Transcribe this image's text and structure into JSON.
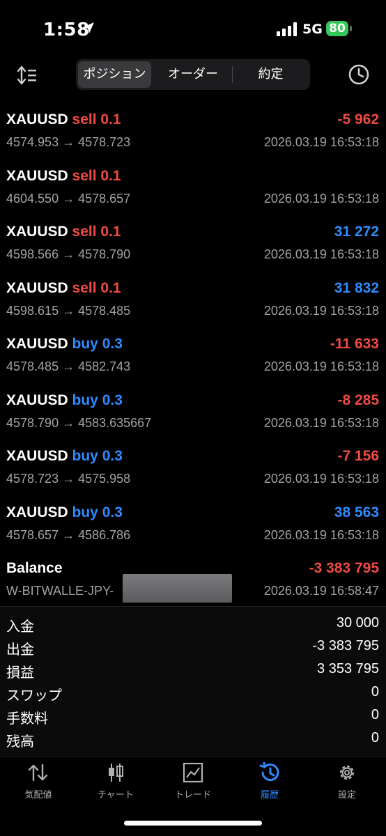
{
  "status_bar": {
    "time": "1:58",
    "network": "5G",
    "battery": "80"
  },
  "segments": [
    "ポジション",
    "オーダー",
    "約定"
  ],
  "active_segment": 0,
  "trades": [
    {
      "symbol": "XAUUSD",
      "side": "sell 0.1",
      "profit": "-5 962",
      "prices": "4574.953 → 4578.723",
      "date": "2026.03.19 16:53:18"
    },
    {
      "symbol": "XAUUSD",
      "side": "sell 0.1",
      "profit": "",
      "prices": "4604.550 → 4578.657",
      "date": "2026.03.19 16:53:18"
    },
    {
      "symbol": "XAUUSD",
      "side": "sell 0.1",
      "profit": "31 272",
      "prices": "4598.566 → 4578.790",
      "date": "2026.03.19 16:53:18"
    },
    {
      "symbol": "XAUUSD",
      "side": "sell 0.1",
      "profit": "31 832",
      "prices": "4598.615 → 4578.485",
      "date": "2026.03.19 16:53:18"
    },
    {
      "symbol": "XAUUSD",
      "side": "buy 0.3",
      "profit": "-11 633",
      "prices": "4578.485 → 4582.743",
      "date": "2026.03.19 16:53:18"
    },
    {
      "symbol": "XAUUSD",
      "side": "buy 0.3",
      "profit": "-8 285",
      "prices": "4578.790 → 4583.635667",
      "date": "2026.03.19 16:53:18"
    },
    {
      "symbol": "XAUUSD",
      "side": "buy 0.3",
      "profit": "-7 156",
      "prices": "4578.723 → 4575.958",
      "date": "2026.03.19 16:53:18"
    },
    {
      "symbol": "XAUUSD",
      "side": "buy 0.3",
      "profit": "38 563",
      "prices": "4578.657 → 4586.786",
      "date": "2026.03.19 16:53:18"
    }
  ],
  "balance": {
    "label": "Balance",
    "amount": "-3 383 795",
    "account": "W-BITWALLE-JPY-",
    "date": "2026.03.19 16:58:47"
  },
  "summary": [
    {
      "label": "入金",
      "value": "30 000"
    },
    {
      "label": "出金",
      "value": "-3 383 795"
    },
    {
      "label": "損益",
      "value": "3 353 795"
    },
    {
      "label": "スワップ",
      "value": "0"
    },
    {
      "label": "手数料",
      "value": "0"
    },
    {
      "label": "残高",
      "value": "0"
    }
  ],
  "tabs": [
    {
      "label": "気配値",
      "icon": "quotes-arrows-icon"
    },
    {
      "label": "チャート",
      "icon": "candlestick-icon"
    },
    {
      "label": "トレード",
      "icon": "trade-chart-icon"
    },
    {
      "label": "履歴",
      "icon": "history-icon"
    },
    {
      "label": "設定",
      "icon": "gear-icon"
    }
  ],
  "active_tab": 3,
  "colors": {
    "negative": "#ef4b43",
    "positive": "#2f8cff",
    "sell": "#ef4b43",
    "buy": "#2f8cff",
    "battery": "#34c759"
  }
}
